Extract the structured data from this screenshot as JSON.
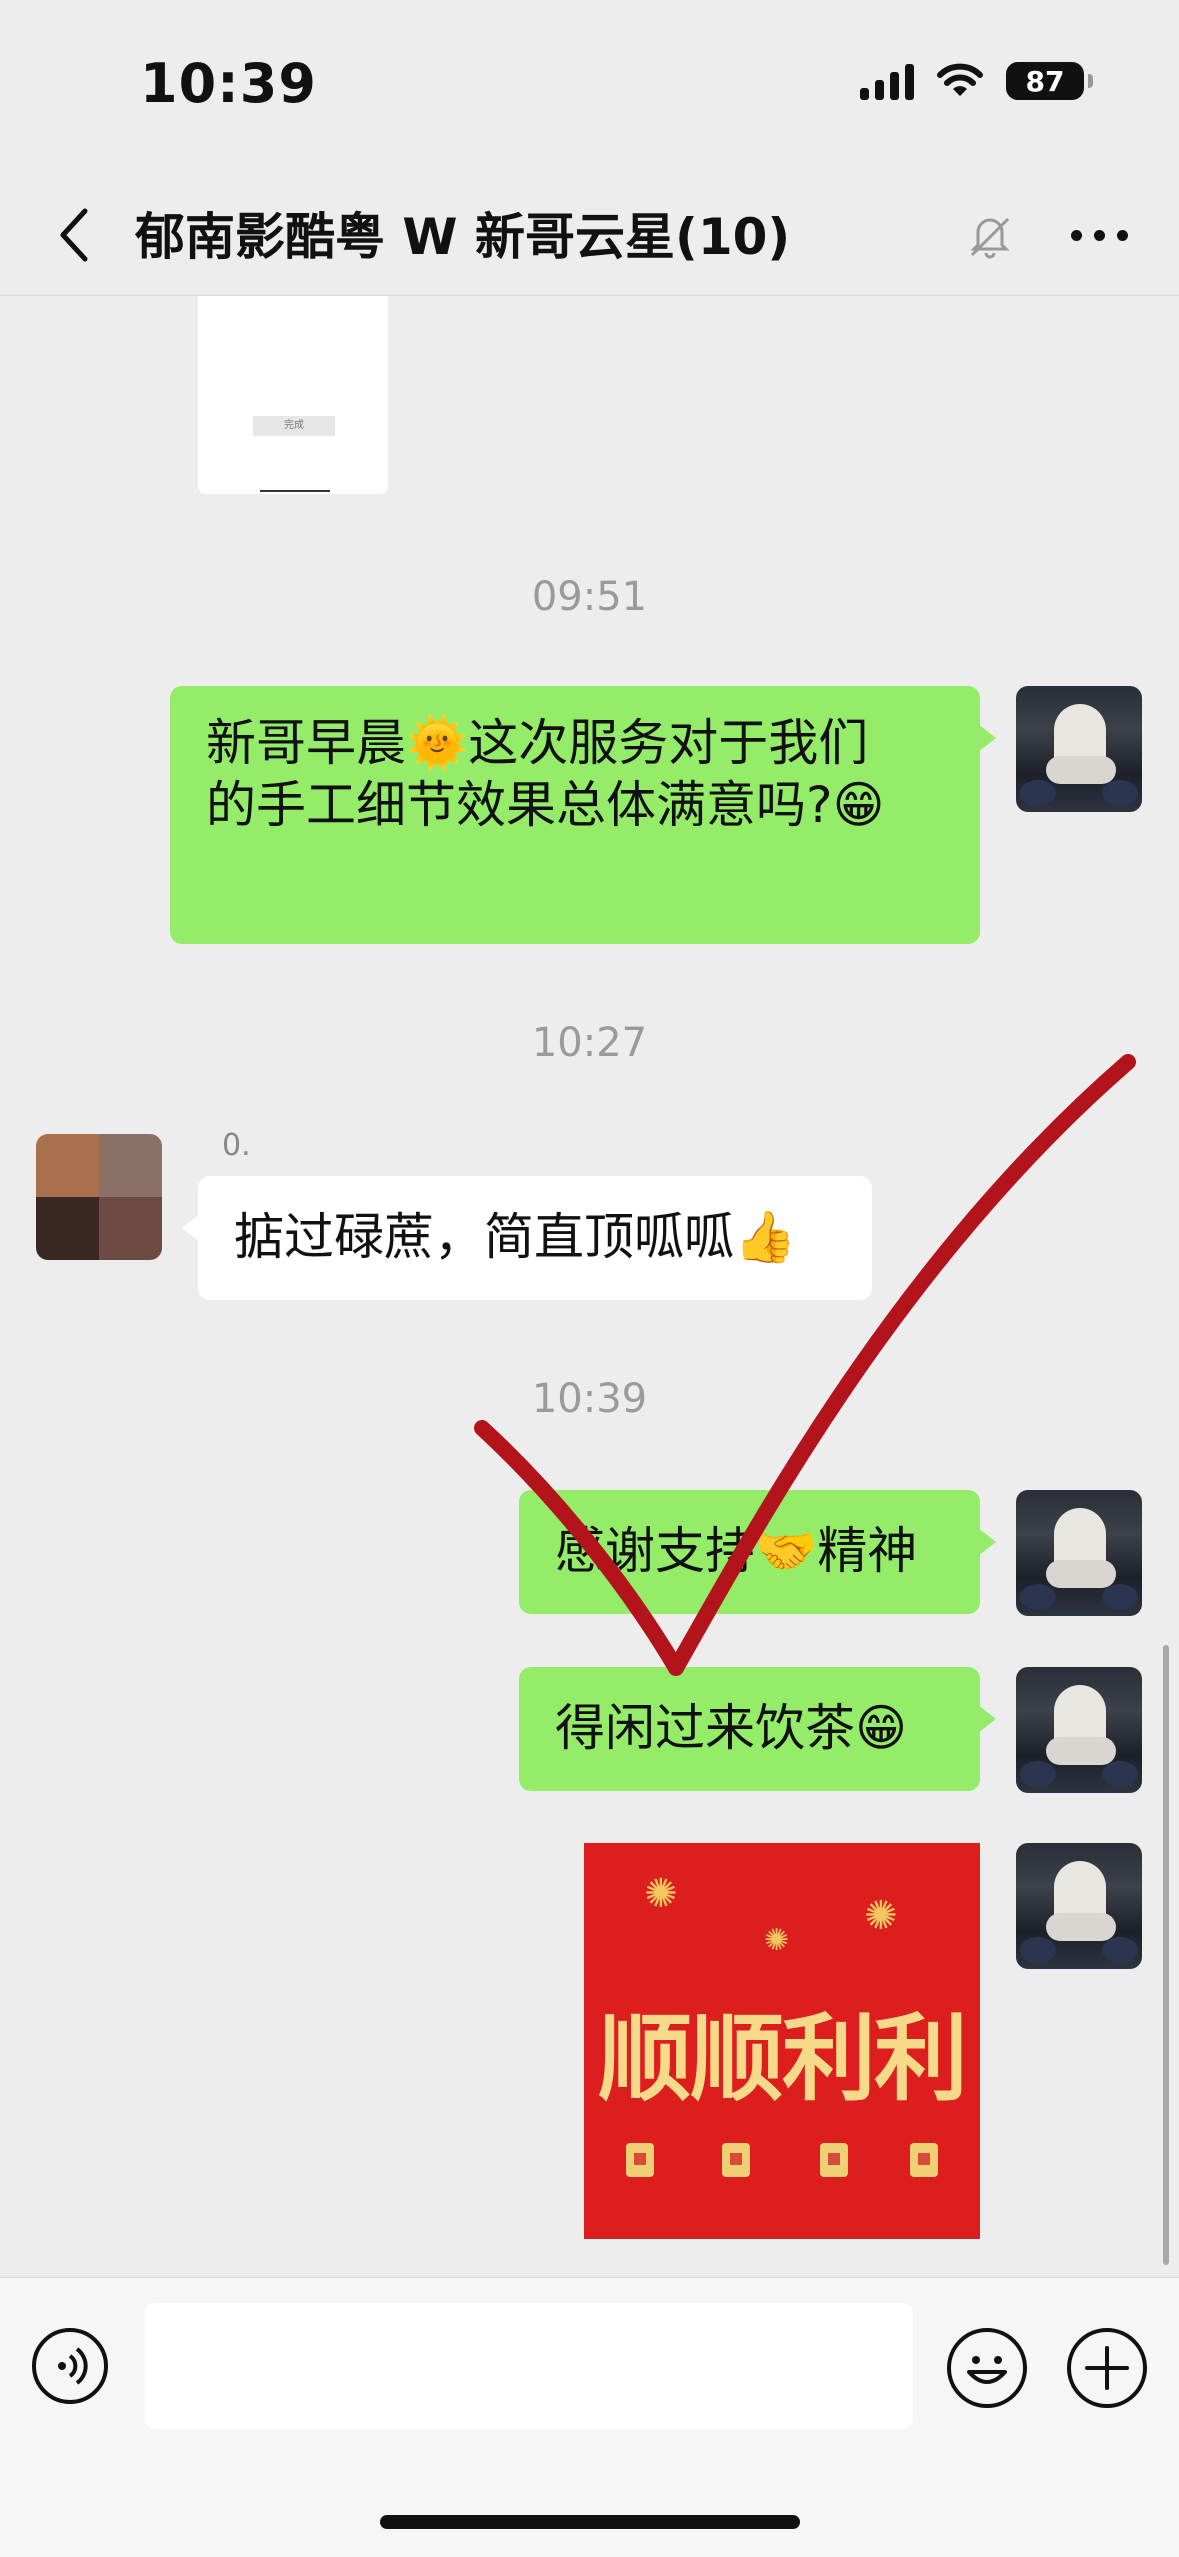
{
  "status_bar": {
    "time": "10:39",
    "battery": "87"
  },
  "header": {
    "title": "郁南影酷粤 W      新哥云星(10)"
  },
  "document_card": {
    "button_label": "完成"
  },
  "messages": {
    "time_1": "09:51",
    "msg_1": {
      "line1": "新哥早晨🌞这次服务对于我们",
      "line2": "的手工细节效果总体满意吗?😁"
    },
    "time_2": "10:27",
    "sender_name_fragment": "0.",
    "msg_2": "掂过碌蔗，简直顶呱呱👍",
    "time_3": "10:39",
    "msg_3": "感谢支持🤝精神",
    "msg_4": "得闲过来饮茶😁",
    "sticker_text": "顺顺利利"
  },
  "input_bar": {
    "placeholder": ""
  },
  "colors": {
    "sent_bubble": "#95ec69",
    "received_bubble": "#ffffff",
    "background": "#ededed",
    "checkmark": "#b3131b"
  }
}
